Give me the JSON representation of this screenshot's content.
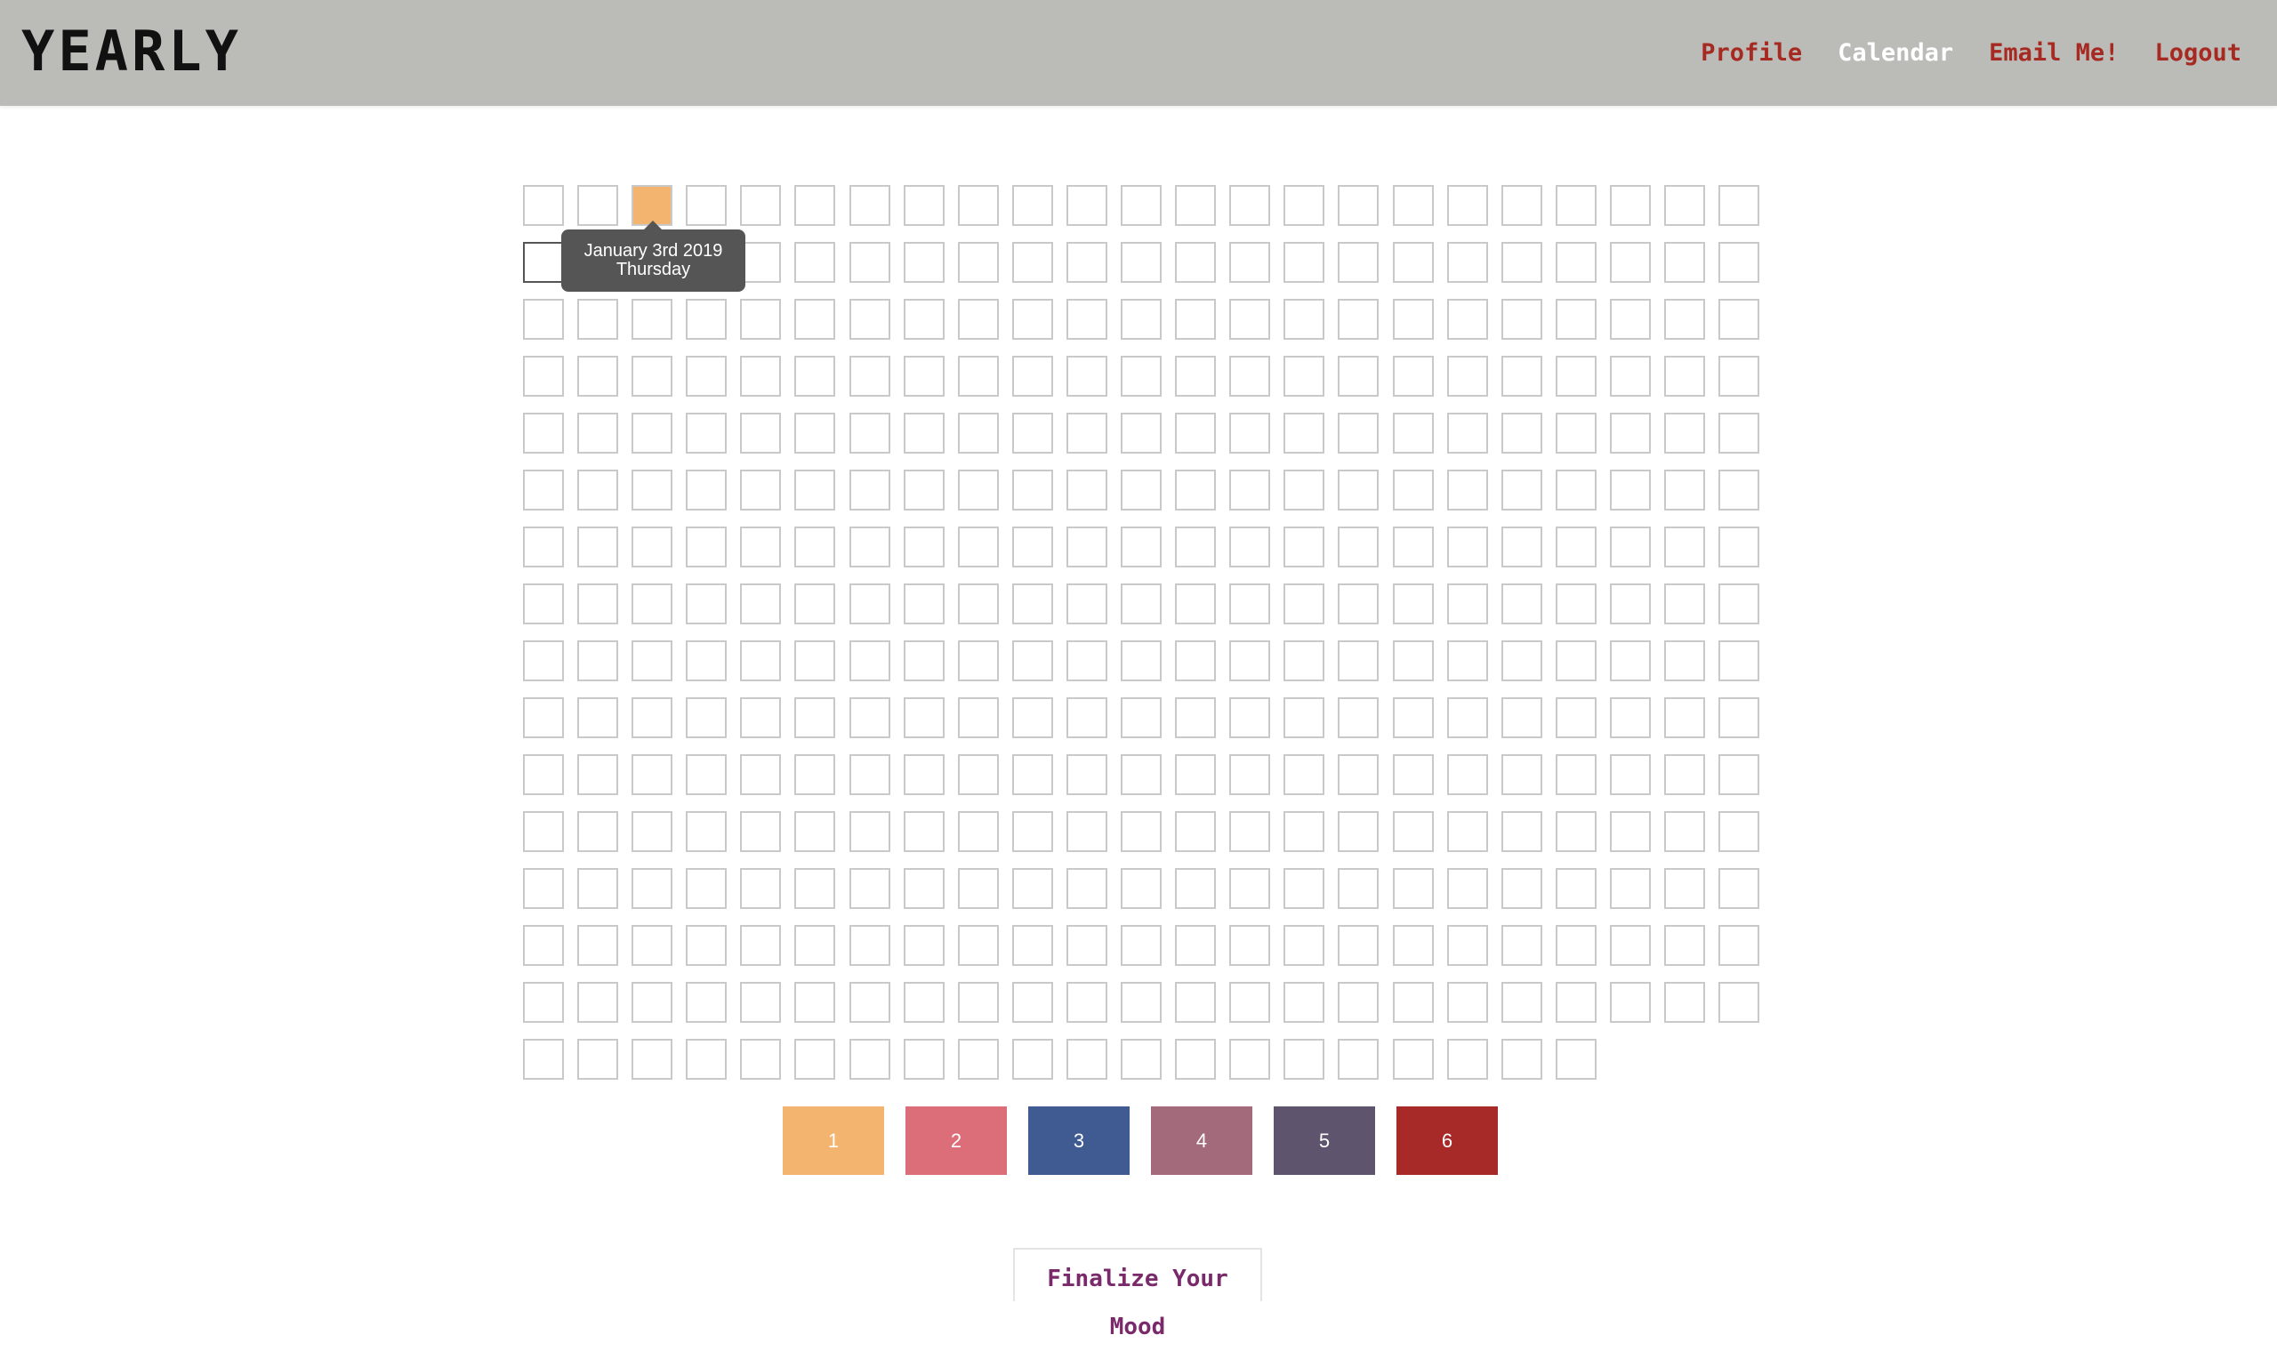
{
  "header": {
    "logo": "YEARLY",
    "nav": [
      {
        "label": "Profile",
        "color": "#a72a22"
      },
      {
        "label": "Calendar",
        "color": "#ffffff"
      },
      {
        "label": "Email Me!",
        "color": "#a72a22"
      },
      {
        "label": "Logout",
        "color": "#a72a22"
      }
    ]
  },
  "calendar": {
    "days_total": 365,
    "columns": 23,
    "filled_days": [
      {
        "day": 3,
        "color": "#f2b46f"
      }
    ],
    "hovered_day": 24,
    "tooltip": {
      "date": "January 3rd 2019",
      "weekday": "Thursday"
    }
  },
  "moods": [
    {
      "label": "1",
      "color": "#f2b46f"
    },
    {
      "label": "2",
      "color": "#dc6e7a"
    },
    {
      "label": "3",
      "color": "#405a92"
    },
    {
      "label": "4",
      "color": "#a36a7c"
    },
    {
      "label": "5",
      "color": "#5e546e"
    },
    {
      "label": "6",
      "color": "#a82a28"
    }
  ],
  "finalize_label": "Finalize Your Mood"
}
